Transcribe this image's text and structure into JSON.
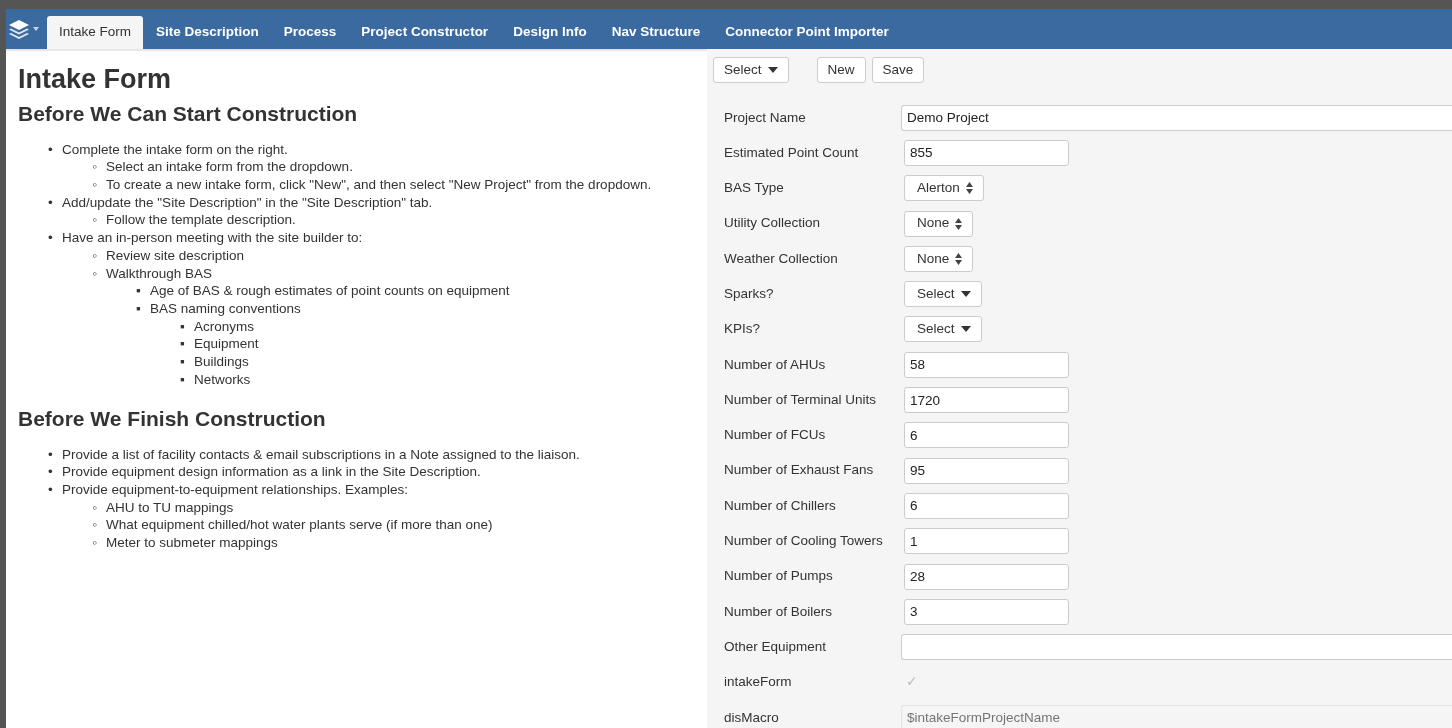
{
  "nav": {
    "tabs": [
      {
        "label": "Intake Form",
        "selected": true
      },
      {
        "label": "Site Description",
        "selected": false
      },
      {
        "label": "Process",
        "selected": false
      },
      {
        "label": "Project Constructor",
        "selected": false
      },
      {
        "label": "Design Info",
        "selected": false
      },
      {
        "label": "Nav Structure",
        "selected": false
      },
      {
        "label": "Connector Point Importer",
        "selected": false
      }
    ]
  },
  "instructions": {
    "title": "Intake Form",
    "sections": [
      {
        "heading": "Before We Can Start Construction",
        "items": [
          {
            "marker": "•",
            "text": "Complete the intake form on the right.",
            "children": [
              {
                "marker": "◦",
                "text": "Select an intake form from the dropdown."
              },
              {
                "marker": "◦",
                "text": "To create a new intake form, click \"New\", and then select \"New Project\" from the dropdown."
              }
            ]
          },
          {
            "marker": "•",
            "text": "Add/update the \"Site Description\" in the \"Site Description\" tab.",
            "children": [
              {
                "marker": "◦",
                "text": "Follow the template description."
              }
            ]
          },
          {
            "marker": "•",
            "text": "Have an in-person meeting with the site builder to:",
            "children": [
              {
                "marker": "◦",
                "text": "Review site description"
              },
              {
                "marker": "◦",
                "text": "Walkthrough BAS",
                "children": [
                  {
                    "marker": "▪",
                    "text": "Age of BAS & rough estimates of point counts on equipment"
                  },
                  {
                    "marker": "▪",
                    "text": "BAS naming conventions",
                    "children": [
                      {
                        "marker": "▪",
                        "text": "Acronyms"
                      },
                      {
                        "marker": "▪",
                        "text": "Equipment"
                      },
                      {
                        "marker": "▪",
                        "text": "Buildings"
                      },
                      {
                        "marker": "▪",
                        "text": "Networks"
                      }
                    ]
                  }
                ]
              }
            ]
          }
        ]
      },
      {
        "heading": "Before We Finish Construction",
        "items": [
          {
            "marker": "•",
            "text": "Provide a list of facility contacts & email subscriptions in a Note assigned to the liaison."
          },
          {
            "marker": "•",
            "text": "Provide equipment design information as a link in the Site Description."
          },
          {
            "marker": "•",
            "text": "Provide equipment-to-equipment relationships. Examples:",
            "children": [
              {
                "marker": "◦",
                "text": "AHU to TU mappings"
              },
              {
                "marker": "◦",
                "text": "What equipment chilled/hot water plants serve (if more than one)"
              },
              {
                "marker": "◦",
                "text": "Meter to submeter mappings"
              }
            ]
          }
        ]
      }
    ]
  },
  "form": {
    "toolbar": {
      "select": "Select",
      "buttons": [
        "New",
        "Save"
      ]
    },
    "fields": [
      {
        "label": "Project Name",
        "kind": "wide-text",
        "value": "Demo Project"
      },
      {
        "label": "Estimated Point Count",
        "kind": "text",
        "value": "855"
      },
      {
        "label": "BAS Type",
        "kind": "spinner",
        "value": "Alerton"
      },
      {
        "label": "Utility Collection",
        "kind": "spinner",
        "value": "None"
      },
      {
        "label": "Weather Collection",
        "kind": "spinner",
        "value": "None"
      },
      {
        "label": "Sparks?",
        "kind": "dropdown",
        "value": "Select"
      },
      {
        "label": "KPIs?",
        "kind": "dropdown",
        "value": "Select"
      },
      {
        "label": "Number of AHUs",
        "kind": "text",
        "value": "58"
      },
      {
        "label": "Number of Terminal Units",
        "kind": "text",
        "value": "1720"
      },
      {
        "label": "Number of FCUs",
        "kind": "text",
        "value": "6"
      },
      {
        "label": "Number of Exhaust Fans",
        "kind": "text",
        "value": "95"
      },
      {
        "label": "Number of Chillers",
        "kind": "text",
        "value": "6"
      },
      {
        "label": "Number of Cooling Towers",
        "kind": "text",
        "value": "1"
      },
      {
        "label": "Number of Pumps",
        "kind": "text",
        "value": "28"
      },
      {
        "label": "Number of Boilers",
        "kind": "text",
        "value": "3"
      },
      {
        "label": "Other Equipment",
        "kind": "wide-text"
      },
      {
        "label": "intakeForm",
        "kind": "check",
        "value": "✓"
      },
      {
        "label": "disMacro",
        "kind": "readonly",
        "placeholder": "$intakeFormProjectName"
      }
    ]
  }
}
